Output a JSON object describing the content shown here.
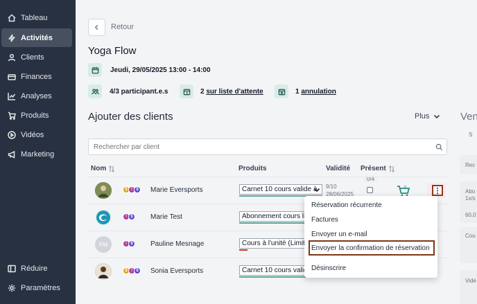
{
  "sidebar": {
    "items": [
      {
        "label": "Tableau",
        "icon": "home-icon"
      },
      {
        "label": "Activités",
        "icon": "bolt-icon",
        "active": true
      },
      {
        "label": "Clients",
        "icon": "user-icon"
      },
      {
        "label": "Finances",
        "icon": "finance-icon"
      },
      {
        "label": "Analyses",
        "icon": "chart-icon"
      },
      {
        "label": "Produits",
        "icon": "cart-icon"
      },
      {
        "label": "Vidéos",
        "icon": "play-icon"
      },
      {
        "label": "Marketing",
        "icon": "megaphone-icon"
      }
    ],
    "bottom": [
      {
        "label": "Réduire",
        "icon": "collapse-icon"
      },
      {
        "label": "Paramètres",
        "icon": "gear-icon"
      }
    ]
  },
  "header": {
    "back_label": "Retour",
    "title": "Yoga Flow",
    "date": "Jeudi, 29/05/2025 13:00 - 14:00",
    "participants": "4/3 participant.e.s",
    "waitlist_count": "2",
    "waitlist_label": "sur liste d'attente",
    "cancel_count": "1",
    "cancel_label": "annulation"
  },
  "clients_section": {
    "title": "Ajouter des clients",
    "more_label": "Plus",
    "right_title": "Ven",
    "search_placeholder": "Rechercher par client",
    "columns": {
      "name": "Nom",
      "products": "Produits",
      "validity": "Validité",
      "present": "Présent"
    },
    "present_count": "0/4",
    "rows": [
      {
        "name": "Marie Eversports",
        "product": "Carnet 10 cours valide à",
        "validity_1": "9/10",
        "validity_2": "28/06/2025",
        "avatar_type": "photo"
      },
      {
        "name": "Marie Test",
        "product": "Abonnement cours li",
        "avatar_type": "logo"
      },
      {
        "name": "Pauline Mesnage",
        "product": "Cours à l'unité (Limite",
        "avatar_type": "initials",
        "initials": "PM"
      },
      {
        "name": "Sonia Eversports",
        "product": "Carnet 10 cours valide",
        "avatar_type": "photo"
      }
    ],
    "cart_count": "0"
  },
  "dropdown": {
    "items": [
      "Réservation récurrente",
      "Factures",
      "Envoyer un e-mail",
      "Envoyer la confirmation de réservation",
      "Désinscrire"
    ]
  },
  "right_panel": {
    "tab": "S",
    "input": "Rec",
    "card1_a": "Abo",
    "card1_b": "1x/s",
    "card1_c": "60,0",
    "card2": "Cou",
    "card3": "Vidé"
  },
  "colors": {
    "sidebar": "#273142",
    "accent": "#5aa39d",
    "highlight": "#7a3816"
  }
}
